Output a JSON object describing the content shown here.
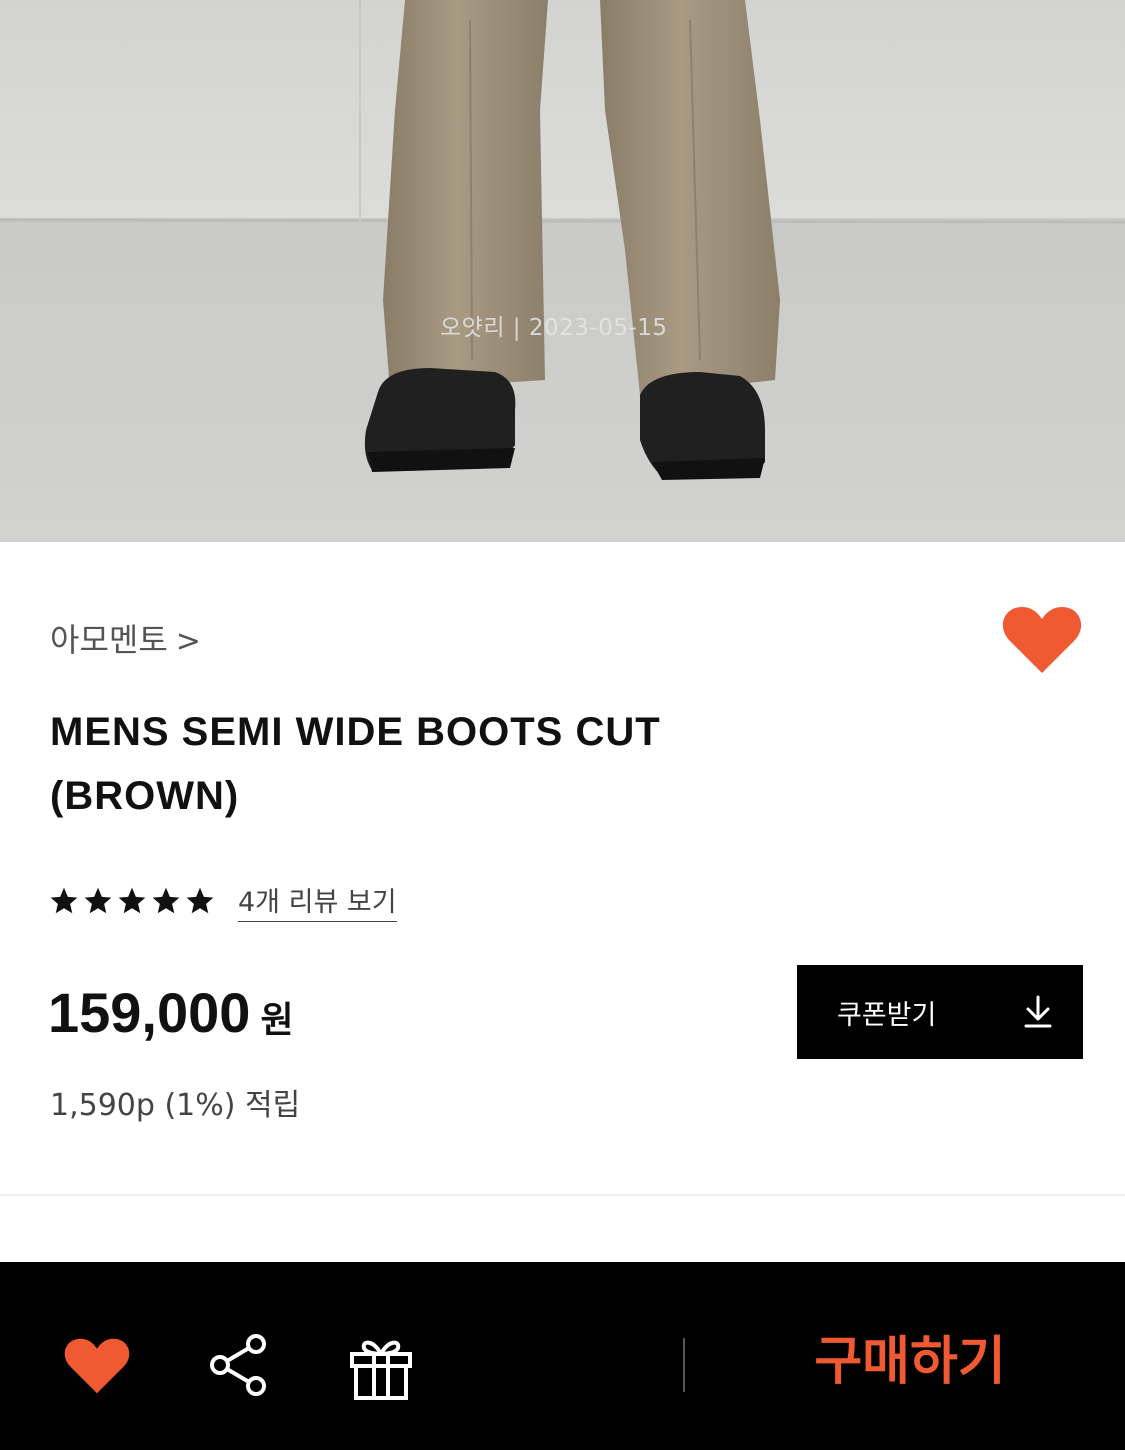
{
  "photo": {
    "alt_subject": "brown-pants-black-boots",
    "watermark": "오얏리 | 2023-05-15"
  },
  "product": {
    "brand": "아모멘토",
    "brand_chevron": ">",
    "title_line1": "MENS SEMI WIDE BOOTS CUT",
    "title_line2": "(BROWN)",
    "rating_stars": 5,
    "rating_max": 5,
    "review_link": "4개 리뷰 보기",
    "price": "159,000",
    "price_unit": "원",
    "points": "1,590p (1%) 적립",
    "coupon_label": "쿠폰받기",
    "wish_icon": "heart-icon"
  },
  "bottom_bar": {
    "wishlist_icon": "heart-icon",
    "share_icon": "share-icon",
    "gift_icon": "gift-icon",
    "buy_label": "구매하기"
  },
  "colors": {
    "accent": "#ef5a32",
    "bar_bg": "#000000",
    "text": "#111111"
  }
}
